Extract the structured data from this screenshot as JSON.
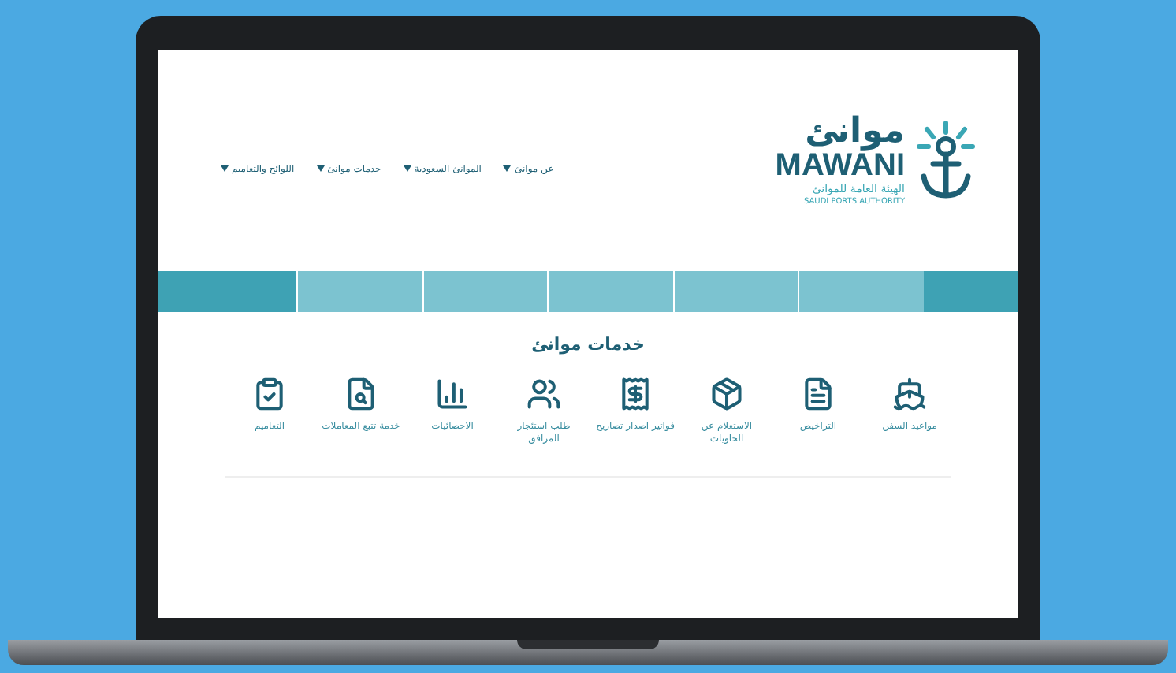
{
  "logo": {
    "name_ar": "موانئ",
    "name_en": "MAWANI",
    "subtitle_ar": "الهيئة العامة للموانئ",
    "subtitle_en": "SAUDI PORTS AUTHORITY"
  },
  "nav": [
    {
      "label": "عن موانئ"
    },
    {
      "label": "الموانئ السعودية"
    },
    {
      "label": "خدمات موانئ"
    },
    {
      "label": "اللوائح والتعاميم"
    }
  ],
  "services": {
    "title": "خدمات موانئ",
    "items": [
      {
        "label": "مواعيد السفن",
        "kind": "ship"
      },
      {
        "label": "التراخيص",
        "kind": "document"
      },
      {
        "label": "الاستعلام عن الحاويات",
        "kind": "package"
      },
      {
        "label": "فواتير اصدار تصاريح",
        "kind": "receipt"
      },
      {
        "label": "طلب استئجار المرافق",
        "kind": "people"
      },
      {
        "label": "الاحصائيات",
        "kind": "chart"
      },
      {
        "label": "خدمة تتبع المعاملات",
        "kind": "search"
      },
      {
        "label": "التعاميم",
        "kind": "clipboard"
      }
    ]
  }
}
